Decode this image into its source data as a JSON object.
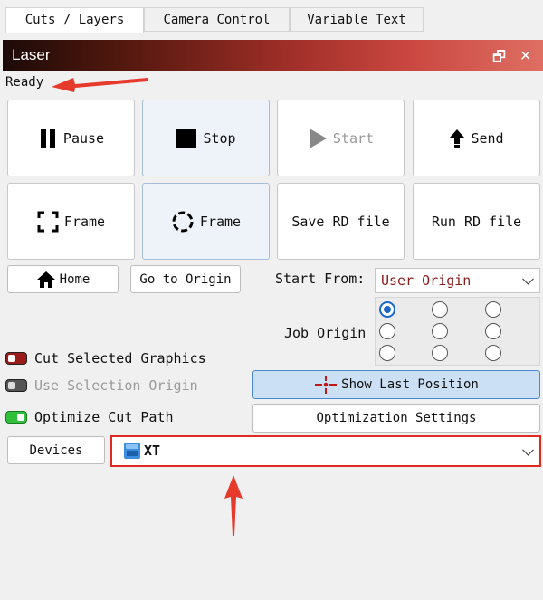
{
  "tabs": [
    "Cuts / Layers",
    "Camera Control",
    "Variable Text"
  ],
  "panel": {
    "title": "Laser",
    "restore_glyph": "🗗",
    "close_glyph": "✕"
  },
  "status": "Ready",
  "buttons": {
    "pause": "Pause",
    "stop": "Stop",
    "start": "Start",
    "send": "Send",
    "frame1": "Frame",
    "frame2": "Frame",
    "save_rd": "Save RD file",
    "run_rd": "Run RD file",
    "home": "Home",
    "go_origin": "Go to Origin",
    "show_last": "Show Last Position",
    "opt_settings": "Optimization Settings",
    "devices": "Devices"
  },
  "start_from": {
    "label": "Start From:",
    "value": "User Origin"
  },
  "job_origin": {
    "label": "Job Origin",
    "selected_index": 0
  },
  "options": {
    "cut_selected": {
      "label": "Cut Selected Graphics",
      "state": "off-red"
    },
    "use_sel_origin": {
      "label": "Use Selection Origin",
      "state": "disabled"
    },
    "optimize": {
      "label": "Optimize Cut Path",
      "state": "on"
    }
  },
  "device": {
    "value": "XT",
    "icon": "device-icon"
  },
  "colors": {
    "accent_red": "#e02a1f",
    "start_from_text": "#8a1a1a",
    "radio_blue": "#1a66c9",
    "toggle_on": "#2fbf3a",
    "toggle_red": "#9b1a1a"
  }
}
